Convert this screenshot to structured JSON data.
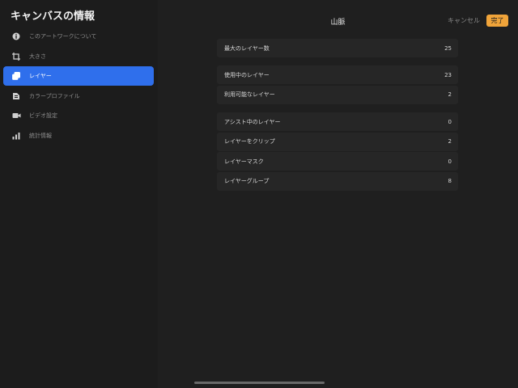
{
  "sidebar": {
    "title": "キャンバスの情報",
    "items": [
      {
        "label": "このアートワークについて",
        "icon": "info-icon",
        "active": false
      },
      {
        "label": "大きさ",
        "icon": "crop-icon",
        "active": false
      },
      {
        "label": "レイヤー",
        "icon": "layers-icon",
        "active": true
      },
      {
        "label": "カラープロファイル",
        "icon": "color-profile-icon",
        "active": false
      },
      {
        "label": "ビデオ設定",
        "icon": "video-camera-icon",
        "active": false
      },
      {
        "label": "統計情報",
        "icon": "bar-chart-icon",
        "active": false
      }
    ]
  },
  "header": {
    "title": "山脈",
    "cancel_label": "キャンセル",
    "done_label": "完了"
  },
  "groups": [
    [
      {
        "label": "最大のレイヤー数",
        "value": "25"
      }
    ],
    [
      {
        "label": "使用中のレイヤー",
        "value": "23"
      },
      {
        "label": "利用可能なレイヤー",
        "value": "2"
      }
    ],
    [
      {
        "label": "アシスト中のレイヤー",
        "value": "0"
      },
      {
        "label": "レイヤーをクリップ",
        "value": "2"
      },
      {
        "label": "レイヤーマスク",
        "value": "0"
      },
      {
        "label": "レイヤーグループ",
        "value": "8"
      }
    ]
  ],
  "colors": {
    "background": "#1f1f1f",
    "row_background": "#262626",
    "accent_active": "#2f6fec",
    "done_button": "#f0a43a"
  }
}
